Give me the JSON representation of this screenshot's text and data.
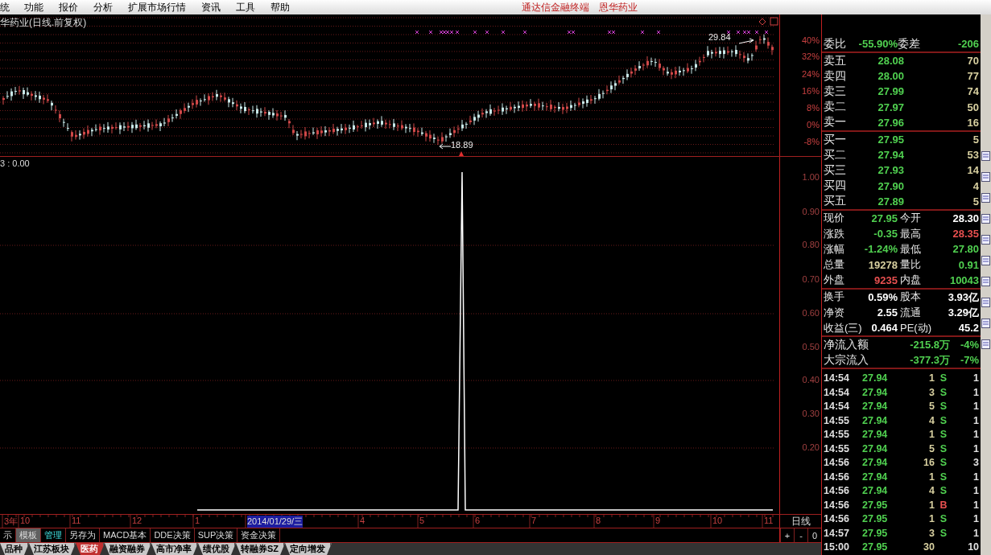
{
  "menu_bar": {
    "items": [
      "统",
      "功能",
      "报价",
      "分析",
      "扩展市场行情",
      "资讯",
      "工具",
      "帮助"
    ],
    "title": "通达信金融终端",
    "stock": "恩华药业"
  },
  "price_chart": {
    "title": "华药业(日线.前复权)",
    "y_labels": [
      "40%",
      "32%",
      "24%",
      "16%",
      "8%",
      "0%",
      "-8%"
    ],
    "high_label": "29.84",
    "low_label": "18.89"
  },
  "indicator": {
    "title": "3 : 0.00",
    "y_labels": [
      "1.00",
      "0.90",
      "0.80",
      "0.70",
      "0.60",
      "0.50",
      "0.40",
      "0.30",
      "0.20"
    ]
  },
  "date_axis": {
    "ticks": [
      {
        "label": "3年",
        "selected": false
      },
      {
        "label": "10",
        "selected": false
      },
      {
        "label": "11",
        "selected": false
      },
      {
        "label": "12",
        "selected": false
      },
      {
        "label": "1",
        "selected": false
      },
      {
        "label": "2014/01/29/三",
        "selected": true
      },
      {
        "label": "4",
        "selected": false
      },
      {
        "label": "5",
        "selected": false
      },
      {
        "label": "6",
        "selected": false
      },
      {
        "label": "7",
        "selected": false
      },
      {
        "label": "8",
        "selected": false
      },
      {
        "label": "9",
        "selected": false
      },
      {
        "label": "10",
        "selected": false
      },
      {
        "label": "11",
        "selected": false
      }
    ],
    "period": "日线"
  },
  "template_bar": [
    {
      "label": "示",
      "selected": false,
      "highlighted": false
    },
    {
      "label": "模板",
      "selected": true,
      "highlighted": false
    },
    {
      "label": "管理",
      "selected": false,
      "highlighted": true
    },
    {
      "label": "另存为",
      "selected": false,
      "highlighted": false
    },
    {
      "label": "MACD基本",
      "selected": false,
      "highlighted": false
    },
    {
      "label": "DDE决策",
      "selected": false,
      "highlighted": false
    },
    {
      "label": "SUP决策",
      "selected": false,
      "highlighted": false
    },
    {
      "label": "资金决策",
      "selected": false,
      "highlighted": false
    }
  ],
  "zoom_buttons": [
    "+",
    "-",
    "0"
  ],
  "sheet_tabs": [
    {
      "label": "品种",
      "selected": false
    },
    {
      "label": "江苏板块",
      "selected": false
    },
    {
      "label": "医药",
      "selected": true
    },
    {
      "label": "融资融券",
      "selected": false
    },
    {
      "label": "高市净率",
      "selected": false
    },
    {
      "label": "绩优股",
      "selected": false
    },
    {
      "label": "转融券SZ",
      "selected": false
    },
    {
      "label": "定向增发",
      "selected": false
    }
  ],
  "order_book": {
    "ratio": {
      "label": "委比",
      "value": "-55.90%",
      "diff_label": "委差",
      "diff": "-206"
    },
    "asks": [
      {
        "label": "卖五",
        "price": "28.08",
        "volume": "70"
      },
      {
        "label": "卖四",
        "price": "28.00",
        "volume": "77"
      },
      {
        "label": "卖三",
        "price": "27.99",
        "volume": "74"
      },
      {
        "label": "卖二",
        "price": "27.97",
        "volume": "50"
      },
      {
        "label": "卖一",
        "price": "27.96",
        "volume": "16"
      }
    ],
    "bids": [
      {
        "label": "买一",
        "price": "27.95",
        "volume": "5"
      },
      {
        "label": "买二",
        "price": "27.94",
        "volume": "53"
      },
      {
        "label": "买三",
        "price": "27.93",
        "volume": "14"
      },
      {
        "label": "买四",
        "price": "27.90",
        "volume": "4"
      },
      {
        "label": "买五",
        "price": "27.89",
        "volume": "5"
      }
    ]
  },
  "quote_sections": [
    {
      "rows": [
        {
          "cells": [
            {
              "label": "现价",
              "value": "27.95",
              "color": "#50d050"
            },
            {
              "label": "今开",
              "value": "28.30"
            }
          ]
        },
        {
          "cells": [
            {
              "label": "涨跌",
              "value": "-0.35",
              "color": "#50d050"
            },
            {
              "label": "最高",
              "value": "28.35",
              "color": "#e85050"
            }
          ]
        },
        {
          "cells": [
            {
              "label": "涨幅",
              "value": "-1.24%",
              "color": "#50d050"
            },
            {
              "label": "最低",
              "value": "27.80",
              "color": "#50d050"
            }
          ]
        },
        {
          "cells": [
            {
              "label": "总量",
              "value": "19278",
              "color": "#d8d0a0"
            },
            {
              "label": "量比",
              "value": "0.91",
              "color": "#50d050"
            }
          ]
        },
        {
          "cells": [
            {
              "label": "外盘",
              "value": "9235",
              "color": "#e85050"
            },
            {
              "label": "内盘",
              "value": "10043",
              "color": "#50d050"
            }
          ]
        }
      ]
    },
    {
      "rows": [
        {
          "cells": [
            {
              "label": "换手",
              "value": "0.59%"
            },
            {
              "label": "股本",
              "value": "3.93亿"
            }
          ]
        },
        {
          "cells": [
            {
              "label": "净资",
              "value": "2.55"
            },
            {
              "label": "流通",
              "value": "3.29亿"
            }
          ]
        },
        {
          "cells": [
            {
              "label": "收益(三)",
              "value": "0.464"
            },
            {
              "label": "PE(动)",
              "value": "45.2"
            }
          ]
        }
      ]
    }
  ],
  "flows": [
    {
      "label": "净流入额",
      "value": "-215.8万",
      "share": "-4%"
    },
    {
      "label": "大宗流入",
      "value": "-377.3万",
      "share": "-7%"
    }
  ],
  "trades": [
    {
      "time": "14:54",
      "price": "27.94",
      "volume": "1",
      "side": "S",
      "kind": "sell",
      "count": "1"
    },
    {
      "time": "14:54",
      "price": "27.94",
      "volume": "3",
      "side": "S",
      "kind": "sell",
      "count": "1"
    },
    {
      "time": "14:54",
      "price": "27.94",
      "volume": "5",
      "side": "S",
      "kind": "sell",
      "count": "1"
    },
    {
      "time": "14:55",
      "price": "27.94",
      "volume": "4",
      "side": "S",
      "kind": "sell",
      "count": "1"
    },
    {
      "time": "14:55",
      "price": "27.94",
      "volume": "1",
      "side": "S",
      "kind": "sell",
      "count": "1"
    },
    {
      "time": "14:55",
      "price": "27.94",
      "volume": "5",
      "side": "S",
      "kind": "sell",
      "count": "1"
    },
    {
      "time": "14:56",
      "price": "27.94",
      "volume": "16",
      "side": "S",
      "kind": "sell",
      "count": "3"
    },
    {
      "time": "14:56",
      "price": "27.94",
      "volume": "1",
      "side": "S",
      "kind": "sell",
      "count": "1"
    },
    {
      "time": "14:56",
      "price": "27.94",
      "volume": "4",
      "side": "S",
      "kind": "sell",
      "count": "1"
    },
    {
      "time": "14:56",
      "price": "27.95",
      "volume": "1",
      "side": "B",
      "kind": "buy",
      "count": "1"
    },
    {
      "time": "14:56",
      "price": "27.95",
      "volume": "1",
      "side": "S",
      "kind": "sell",
      "count": "1"
    },
    {
      "time": "14:57",
      "price": "27.95",
      "volume": "3",
      "side": "S",
      "kind": "sell",
      "count": "1"
    },
    {
      "time": "15:00",
      "price": "27.95",
      "volume": "30",
      "kind": "none",
      "count": "10"
    }
  ]
}
